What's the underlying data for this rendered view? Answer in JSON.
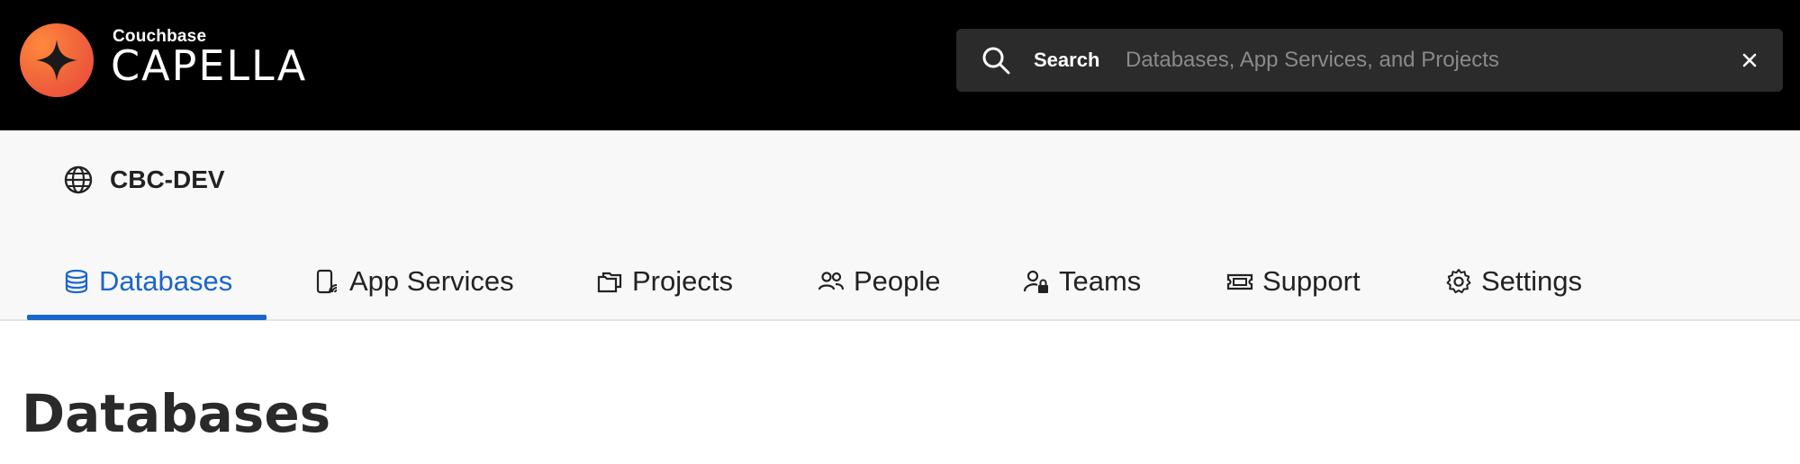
{
  "brand": {
    "company": "Couchbase",
    "product": "CAPELLA",
    "logo_icon": "sparkle-icon",
    "logo_colors": [
      "#ff8a3d",
      "#e8453e"
    ]
  },
  "search": {
    "label": "Search",
    "placeholder": "Databases, App Services, and Projects",
    "value": "",
    "clear_symbol": "×"
  },
  "organization": {
    "name": "CBC-DEV",
    "icon": "globe-icon"
  },
  "tabs": [
    {
      "label": "Databases",
      "icon": "database-icon",
      "active": true
    },
    {
      "label": "App Services",
      "icon": "mobile-device-icon",
      "active": false
    },
    {
      "label": "Projects",
      "icon": "folders-icon",
      "active": false
    },
    {
      "label": "People",
      "icon": "people-icon",
      "active": false
    },
    {
      "label": "Teams",
      "icon": "user-lock-icon",
      "active": false
    },
    {
      "label": "Support",
      "icon": "ticket-icon",
      "active": false
    },
    {
      "label": "Settings",
      "icon": "gear-icon",
      "active": false
    }
  ],
  "main": {
    "title": "Databases"
  },
  "colors": {
    "accent": "#1a66c9",
    "topbar": "#000000",
    "subheader": "#f8f8f8"
  }
}
